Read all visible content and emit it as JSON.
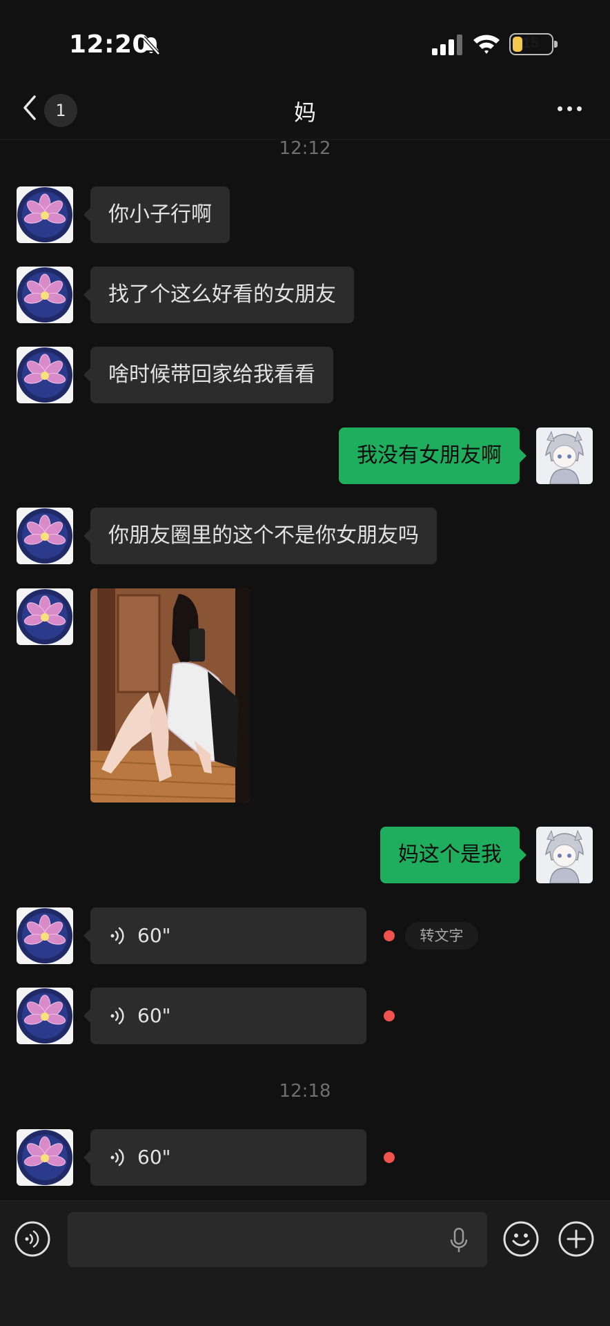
{
  "status_bar": {
    "time": "12:20",
    "battery": "15"
  },
  "nav": {
    "back_badge": "1",
    "title": "妈"
  },
  "messages": {
    "ts1": "12:12",
    "m1": "你小子行啊",
    "m2": "找了个这么好看的女朋友",
    "m3": "啥时候带回家给我看看",
    "m4": "我没有女朋友啊",
    "m5": "你朋友圈里的这个不是你女朋友吗",
    "m7": "妈这个是我",
    "v1": "60\"",
    "v1_transcribe": "转文字",
    "v2": "60\"",
    "ts2": "12:18",
    "v3": "60\""
  },
  "colors": {
    "incoming": "#2c2c2c",
    "outgoing": "#1fad5e",
    "unread_dot": "#f0524d",
    "background": "#111111"
  },
  "icons": [
    "bell-slash-icon",
    "signal-icon",
    "wifi-icon",
    "battery-icon",
    "chevron-left-icon",
    "more-icon",
    "lotus-avatar",
    "anime-avatar",
    "voice-wave-icon",
    "microphone-icon",
    "emoji-icon",
    "plus-icon"
  ]
}
